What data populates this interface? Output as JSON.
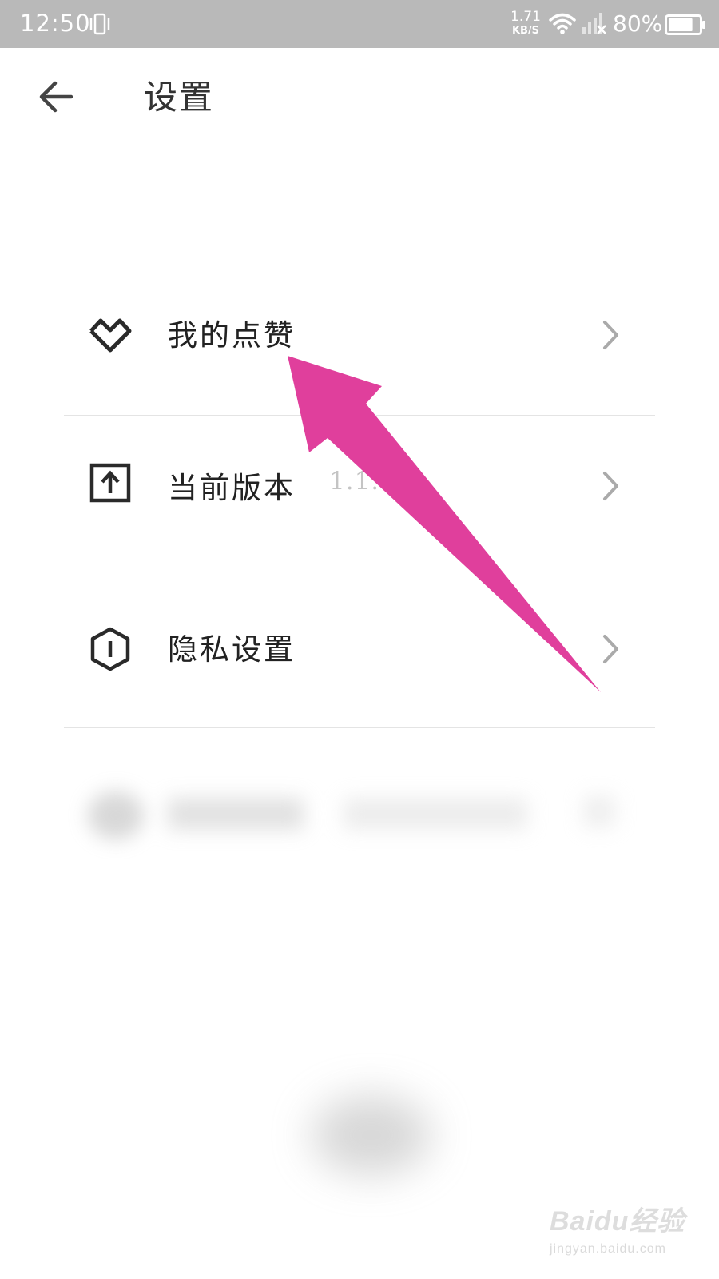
{
  "status_bar": {
    "time": "12:50",
    "net_speed_value": "1.71",
    "net_speed_unit": "KB/S",
    "battery": "80%",
    "battery_level": 0.8
  },
  "header": {
    "title": "设置"
  },
  "settings": {
    "items": [
      {
        "label": "我的点赞",
        "icon": "heart-outline-icon"
      },
      {
        "label": "当前版本",
        "value": "1.1.4",
        "icon": "upload-icon"
      },
      {
        "label": "隐私设置",
        "icon": "hexagon-info-icon"
      }
    ]
  },
  "annotation": {
    "color": "#e03f9c"
  },
  "watermark": {
    "brand": "Baidu经验",
    "url": "jingyan.baidu.com"
  }
}
